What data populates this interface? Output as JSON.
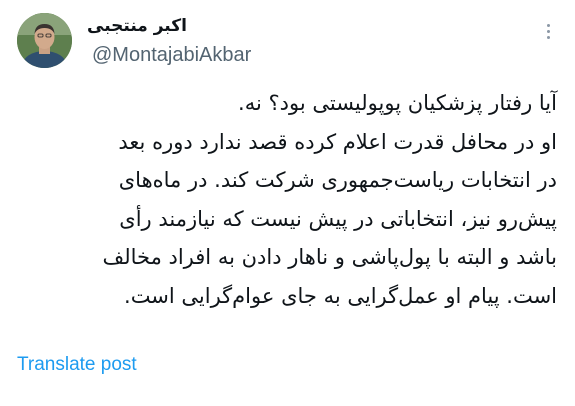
{
  "author": {
    "display_name": "اکبر منتجبی",
    "handle": "@MontajabiAkbar"
  },
  "icons": {
    "avatar": "profile-photo",
    "more": "more-options-icon"
  },
  "tweet": {
    "lines": [
      "آیا رفتار پزشکیان پوپولیستی بود؟ نه.",
      "او در محافل قدرت اعلام کرده قصد ندارد دوره بعد",
      "در انتخابات ریاست‌جمهوری شرکت کند. در ماه‌های",
      "پیش‌رو نیز، انتخاباتی در پیش نیست که نیازمند رأی",
      "باشد و البته با پول‌پاشی و ناهار دادن به افراد مخالف",
      "است. پیام او عمل‌گرایی به جای عوام‌گرایی است."
    ]
  },
  "actions": {
    "translate_label": "Translate post"
  },
  "colors": {
    "text": "#0f1419",
    "secondary": "#536471",
    "link": "#1d9bf0"
  }
}
